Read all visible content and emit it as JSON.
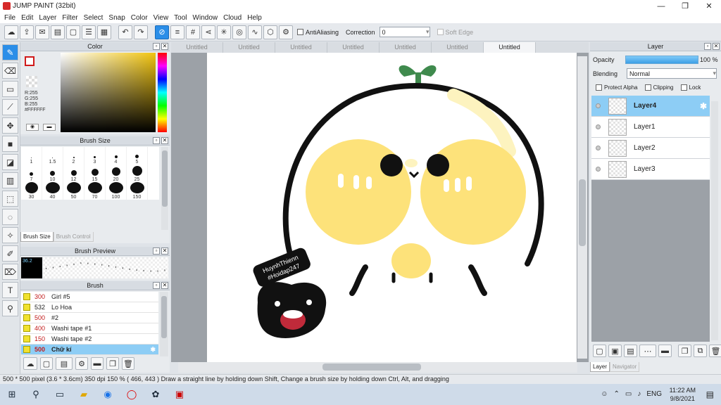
{
  "window": {
    "title": "JUMP PAINT (32bit)",
    "min": "—",
    "max": "❐",
    "close": "✕"
  },
  "menu": [
    "File",
    "Edit",
    "Layer",
    "Filter",
    "Select",
    "Snap",
    "Color",
    "View",
    "Tool",
    "Window",
    "Cloud",
    "Help"
  ],
  "toolbar": {
    "antialiasing_label": "AntiAliasing",
    "correction_label": "Correction",
    "correction_value": "0",
    "softedge_label": "Soft Edge"
  },
  "color_panel": {
    "title": "Color",
    "r": "R:255",
    "g": "G:255",
    "b": "B:255",
    "hex": "#FFFFFF"
  },
  "brush_size": {
    "title": "Brush Size",
    "sizes": [
      "1",
      "1.5",
      "2",
      "3",
      "4",
      "5",
      "7",
      "10",
      "12",
      "15",
      "20",
      "25",
      "30",
      "40",
      "50",
      "70",
      "100",
      "150"
    ],
    "tab_active": "Brush Size",
    "tab_other": "Brush Control"
  },
  "brush_preview": {
    "title": "Brush Preview",
    "value": "36.2"
  },
  "brush_list": {
    "title": "Brush",
    "items": [
      {
        "num": "300",
        "name": "Girl #5"
      },
      {
        "num": "532",
        "name": "Lo Hoa"
      },
      {
        "num": "500",
        "name": "#2"
      },
      {
        "num": "400",
        "name": "Washi tape #1"
      },
      {
        "num": "150",
        "name": "Washi tape #2"
      },
      {
        "num": "500",
        "name": "Chữ kí"
      }
    ]
  },
  "tabs": [
    "Untitled",
    "Untitled",
    "Untitled",
    "Untitled",
    "Untitled",
    "Untitled",
    "Untitled"
  ],
  "canvas": {
    "stamp_line1": "HuynhThienn",
    "stamp_line2": "#Hoidap247"
  },
  "layer_panel": {
    "title": "Layer",
    "opacity_label": "Opacity",
    "opacity_value": "100 %",
    "blending_label": "Blending",
    "blending_value": "Normal",
    "protect_alpha": "Protect Alpha",
    "clipping": "Clipping",
    "lock": "Lock",
    "layers": [
      "Layer4",
      "Layer1",
      "Layer2",
      "Layer3"
    ],
    "tab_active": "Layer",
    "tab_other": "Navigator"
  },
  "status": {
    "text": "500 * 500 pixel   (3.6 * 3.6cm)   350 dpi   150 %   ( 466, 443 )   Draw a straight line by holding down Shift, Change a brush size by holding down Ctrl, Alt, and dragging"
  },
  "taskbar": {
    "lang": "ENG",
    "time": "11:22 AM",
    "date": "9/8/2021"
  }
}
